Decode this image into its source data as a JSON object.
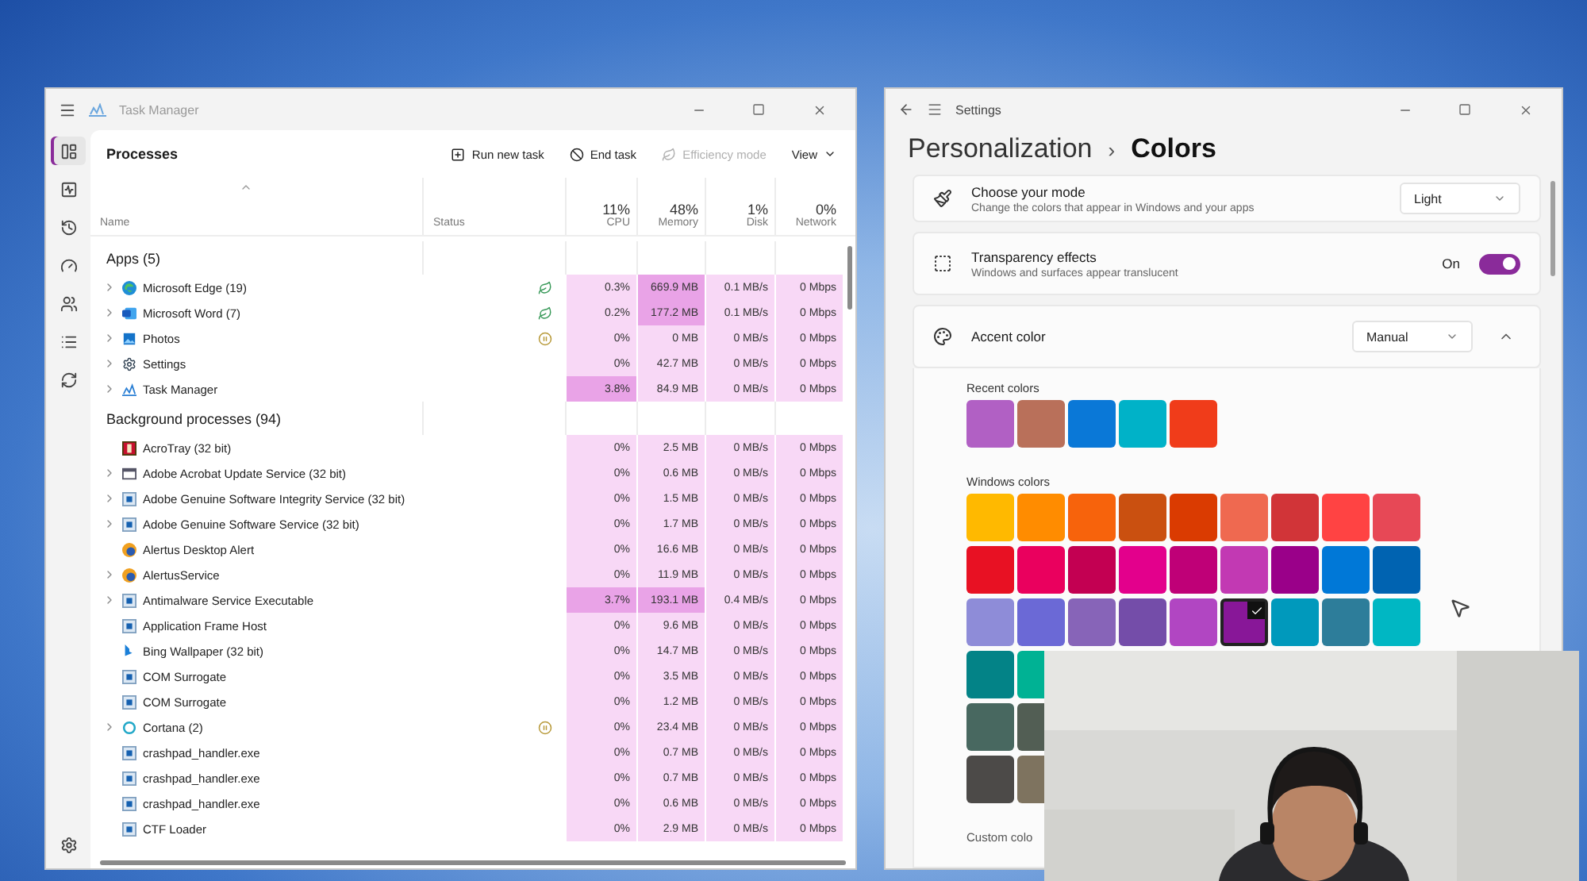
{
  "task_manager": {
    "title": "Task Manager",
    "nav": [
      {
        "selected": true
      },
      {
        "selected": false
      },
      {
        "selected": false
      },
      {
        "selected": false
      },
      {
        "selected": false
      },
      {
        "selected": false
      },
      {
        "selected": false
      }
    ],
    "section": "Processes",
    "commands": [
      {
        "label": "Run new task",
        "disabled": false
      },
      {
        "label": "End task",
        "disabled": false
      },
      {
        "label": "Efficiency mode",
        "disabled": true
      },
      {
        "label": "View",
        "disabled": false
      }
    ],
    "columns": [
      {
        "label": "Name"
      },
      {
        "label": "Status"
      },
      {
        "total": "11%",
        "label": "CPU"
      },
      {
        "total": "48%",
        "label": "Memory"
      },
      {
        "total": "1%",
        "label": "Disk"
      },
      {
        "total": "0%",
        "label": "Network"
      }
    ],
    "groups": [
      {
        "title": "Apps (5)",
        "rows": [
          {
            "name": "Microsoft Edge (19)",
            "expandable": true,
            "kind": "efficiency",
            "cpu": "0.3%",
            "memory": "669.9 MB",
            "disk": "0.1 MB/s",
            "network": "0 Mbps",
            "cpu_high": false,
            "memory_high": true
          },
          {
            "name": "Microsoft Word (7)",
            "expandable": true,
            "kind": "efficiency",
            "cpu": "0.2%",
            "memory": "177.2 MB",
            "disk": "0.1 MB/s",
            "network": "0 Mbps",
            "cpu_high": false,
            "memory_high": true
          },
          {
            "name": "Photos",
            "expandable": true,
            "kind": "suspended",
            "cpu": "0%",
            "memory": "0 MB",
            "disk": "0 MB/s",
            "network": "0 Mbps",
            "cpu_high": false,
            "memory_high": false
          },
          {
            "name": "Settings",
            "expandable": true,
            "cpu": "0%",
            "memory": "42.7 MB",
            "disk": "0 MB/s",
            "network": "0 Mbps",
            "cpu_high": false,
            "memory_high": false
          },
          {
            "name": "Task Manager",
            "expandable": true,
            "cpu": "3.8%",
            "memory": "84.9 MB",
            "disk": "0 MB/s",
            "network": "0 Mbps",
            "cpu_high": true,
            "memory_high": false
          }
        ]
      },
      {
        "title": "Background processes (94)",
        "rows": [
          {
            "name": "AcroTray (32 bit)",
            "expandable": false,
            "cpu": "0%",
            "memory": "2.5 MB",
            "disk": "0 MB/s",
            "network": "0 Mbps",
            "cpu_high": false,
            "memory_high": false
          },
          {
            "name": "Adobe Acrobat Update Service (32 bit)",
            "expandable": true,
            "cpu": "0%",
            "memory": "0.6 MB",
            "disk": "0 MB/s",
            "network": "0 Mbps",
            "cpu_high": false,
            "memory_high": false
          },
          {
            "name": "Adobe Genuine Software Integrity Service (32 bit)",
            "expandable": true,
            "cpu": "0%",
            "memory": "1.5 MB",
            "disk": "0 MB/s",
            "network": "0 Mbps",
            "cpu_high": false,
            "memory_high": false
          },
          {
            "name": "Adobe Genuine Software Service (32 bit)",
            "expandable": true,
            "cpu": "0%",
            "memory": "1.7 MB",
            "disk": "0 MB/s",
            "network": "0 Mbps",
            "cpu_high": false,
            "memory_high": false
          },
          {
            "name": "Alertus Desktop Alert",
            "expandable": false,
            "cpu": "0%",
            "memory": "16.6 MB",
            "disk": "0 MB/s",
            "network": "0 Mbps",
            "cpu_high": false,
            "memory_high": false
          },
          {
            "name": "AlertusService",
            "expandable": true,
            "cpu": "0%",
            "memory": "11.9 MB",
            "disk": "0 MB/s",
            "network": "0 Mbps",
            "cpu_high": false,
            "memory_high": false
          },
          {
            "name": "Antimalware Service Executable",
            "expandable": true,
            "cpu": "3.7%",
            "memory": "193.1 MB",
            "disk": "0.4 MB/s",
            "network": "0 Mbps",
            "cpu_high": true,
            "memory_high": true
          },
          {
            "name": "Application Frame Host",
            "expandable": false,
            "cpu": "0%",
            "memory": "9.6 MB",
            "disk": "0 MB/s",
            "network": "0 Mbps",
            "cpu_high": false,
            "memory_high": false
          },
          {
            "name": "Bing Wallpaper (32 bit)",
            "expandable": false,
            "cpu": "0%",
            "memory": "14.7 MB",
            "disk": "0 MB/s",
            "network": "0 Mbps",
            "cpu_high": false,
            "memory_high": false
          },
          {
            "name": "COM Surrogate",
            "expandable": false,
            "cpu": "0%",
            "memory": "3.5 MB",
            "disk": "0 MB/s",
            "network": "0 Mbps",
            "cpu_high": false,
            "memory_high": false
          },
          {
            "name": "COM Surrogate",
            "expandable": false,
            "cpu": "0%",
            "memory": "1.2 MB",
            "disk": "0 MB/s",
            "network": "0 Mbps",
            "cpu_high": false,
            "memory_high": false
          },
          {
            "name": "Cortana (2)",
            "expandable": true,
            "kind": "suspended",
            "cpu": "0%",
            "memory": "23.4 MB",
            "disk": "0 MB/s",
            "network": "0 Mbps",
            "cpu_high": false,
            "memory_high": false
          },
          {
            "name": "crashpad_handler.exe",
            "expandable": false,
            "cpu": "0%",
            "memory": "0.7 MB",
            "disk": "0 MB/s",
            "network": "0 Mbps",
            "cpu_high": false,
            "memory_high": false
          },
          {
            "name": "crashpad_handler.exe",
            "expandable": false,
            "cpu": "0%",
            "memory": "0.7 MB",
            "disk": "0 MB/s",
            "network": "0 Mbps",
            "cpu_high": false,
            "memory_high": false
          },
          {
            "name": "crashpad_handler.exe",
            "expandable": false,
            "cpu": "0%",
            "memory": "0.6 MB",
            "disk": "0 MB/s",
            "network": "0 Mbps",
            "cpu_high": false,
            "memory_high": false
          },
          {
            "name": "CTF Loader",
            "expandable": false,
            "cpu": "0%",
            "memory": "2.9 MB",
            "disk": "0 MB/s",
            "network": "0 Mbps",
            "cpu_high": false,
            "memory_high": false
          }
        ]
      }
    ]
  },
  "settings": {
    "title": "Settings",
    "breadcrumb": {
      "parent": "Personalization",
      "separator": "›",
      "current": "Colors"
    },
    "mode": {
      "title": "Choose your mode",
      "description": "Change the colors that appear in Windows and your apps",
      "value": "Light"
    },
    "transparency": {
      "title": "Transparency effects",
      "description": "Windows and surfaces appear translucent",
      "state": "On",
      "on": true
    },
    "accent": {
      "title": "Accent color",
      "value": "Manual",
      "expanded": true,
      "recent_label": "Recent colors",
      "recent": [
        {
          "color": "#b160c4",
          "selected": false
        },
        {
          "color": "#b9705a",
          "selected": false
        },
        {
          "color": "#0a78d7",
          "selected": false
        },
        {
          "color": "#00b2c8",
          "selected": false
        },
        {
          "color": "#f03c1a",
          "selected": false
        }
      ],
      "windows_label": "Windows colors",
      "windows_rows": [
        [
          {
            "color": "#ffb900",
            "selected": false
          },
          {
            "color": "#ff8c00",
            "selected": false
          },
          {
            "color": "#f7630c",
            "selected": false
          },
          {
            "color": "#ca5010",
            "selected": false
          },
          {
            "color": "#da3b01",
            "selected": false
          },
          {
            "color": "#ef6950",
            "selected": false
          },
          {
            "color": "#d13438",
            "selected": false
          },
          {
            "color": "#ff4343",
            "selected": false
          },
          {
            "color": "#e74856",
            "selected": false
          }
        ],
        [
          {
            "color": "#e81123",
            "selected": false
          },
          {
            "color": "#ea005e",
            "selected": false
          },
          {
            "color": "#c30052",
            "selected": false
          },
          {
            "color": "#e3008c",
            "selected": false
          },
          {
            "color": "#bf0077",
            "selected": false
          },
          {
            "color": "#c239b3",
            "selected": false
          },
          {
            "color": "#9a0089",
            "selected": false
          },
          {
            "color": "#0078d7",
            "selected": false
          },
          {
            "color": "#0063b1",
            "selected": false
          }
        ],
        [
          {
            "color": "#8e8cd8",
            "selected": false
          },
          {
            "color": "#6b69d6",
            "selected": false
          },
          {
            "color": "#8764b8",
            "selected": false
          },
          {
            "color": "#744da9",
            "selected": false
          },
          {
            "color": "#b146c2",
            "selected": false
          },
          {
            "color": "#881798",
            "selected": true
          },
          {
            "color": "#0099bc",
            "selected": false
          },
          {
            "color": "#2d7d9a",
            "selected": false
          },
          {
            "color": "#00b7c3",
            "selected": false
          }
        ],
        [
          {
            "color": "#038387",
            "selected": false
          },
          {
            "color": "#00b294",
            "selected": false
          }
        ],
        [
          {
            "color": "#486860",
            "selected": false
          },
          {
            "color": "#525e54",
            "selected": false
          }
        ],
        [
          {
            "color": "#4c4a48",
            "selected": false
          },
          {
            "color": "#7e735f",
            "selected": false
          }
        ]
      ],
      "custom_label": "Custom colo"
    }
  }
}
